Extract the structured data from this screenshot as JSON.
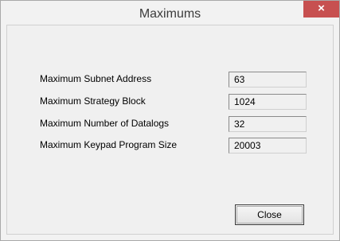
{
  "window": {
    "title": "Maximums",
    "close_glyph": "×"
  },
  "fields": [
    {
      "label": "Maximum Subnet Address",
      "value": "63"
    },
    {
      "label": "Maximum Strategy Block",
      "value": "1024"
    },
    {
      "label": "Maximum Number of Datalogs",
      "value": "32"
    },
    {
      "label": "Maximum Keypad Program Size",
      "value": "20003"
    }
  ],
  "buttons": {
    "close_label": "Close"
  },
  "colors": {
    "titlebar_close_bg": "#c75050",
    "window_bg": "#f2f2f2"
  }
}
